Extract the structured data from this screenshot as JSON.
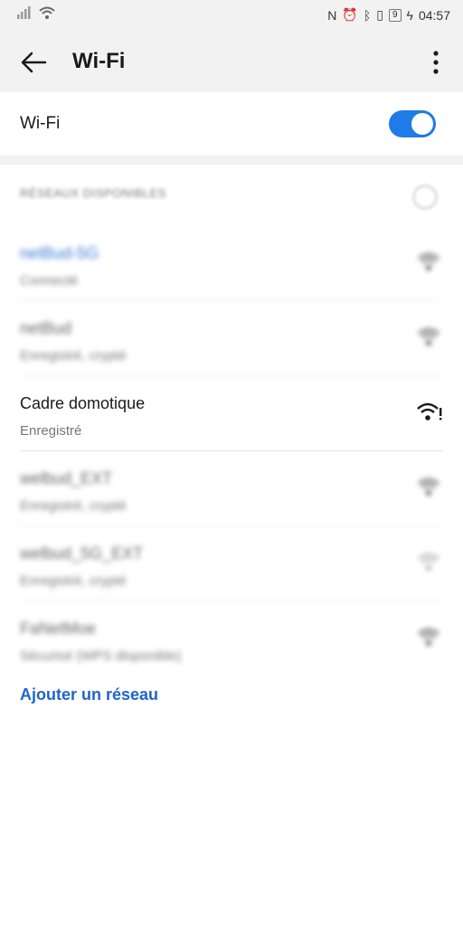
{
  "statusbar": {
    "time": "04:57",
    "battery": "9"
  },
  "appbar": {
    "title": "Wi-Fi"
  },
  "wifi_toggle": {
    "label": "Wi-Fi",
    "state": "on"
  },
  "networks": {
    "section_title": "RÉSEAUX DISPONIBLES",
    "items": [
      {
        "name": "netBud-5G",
        "status": "Connecté"
      },
      {
        "name": "netBud",
        "status": "Enregistré, crypté"
      },
      {
        "name": "Cadre domotique",
        "status": "Enregistré"
      },
      {
        "name": "welbud_EXT",
        "status": "Enregistré, crypté"
      },
      {
        "name": "welbud_5G_EXT",
        "status": "Enregistré, crypté"
      },
      {
        "name": "FaNetMoe",
        "status": "Sécurisé (WPS disponible)"
      }
    ]
  },
  "add_network": "Ajouter un réseau",
  "colors": {
    "accent": "#1e7be8",
    "link": "#1e66c8"
  }
}
